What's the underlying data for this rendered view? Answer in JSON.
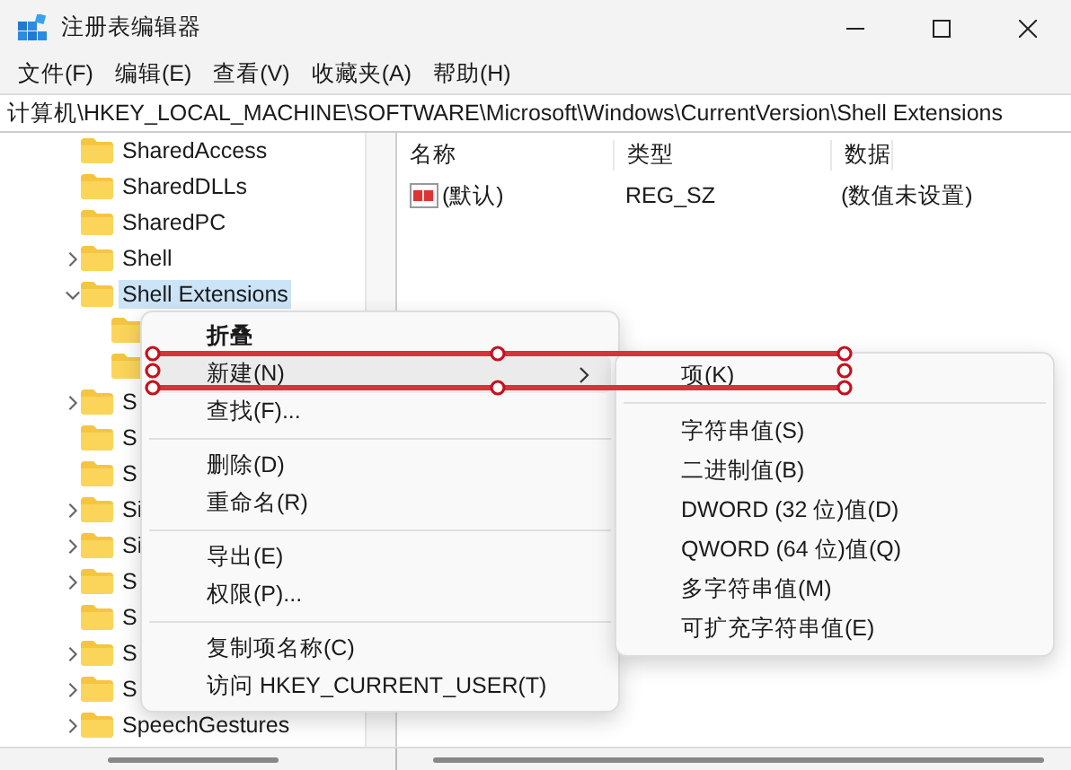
{
  "window": {
    "title": "注册表编辑器"
  },
  "menu": [
    "文件(F)",
    "编辑(E)",
    "查看(V)",
    "收藏夹(A)",
    "帮助(H)"
  ],
  "address": "计算机\\HKEY_LOCAL_MACHINE\\SOFTWARE\\Microsoft\\Windows\\CurrentVersion\\Shell Extensions",
  "tree": [
    {
      "name": "SharedAccess",
      "selected": false
    },
    {
      "name": "SharedDLLs",
      "selected": false
    },
    {
      "name": "SharedPC",
      "selected": false
    },
    {
      "name": "Shell",
      "expanded": false,
      "selected": false
    },
    {
      "name": "Shell Extensions",
      "expanded": true,
      "selected": true,
      "children": [
        {
          "selected": false
        },
        {
          "selected": false
        }
      ]
    },
    {
      "name": "S",
      "expanded": false,
      "selected": false
    },
    {
      "name": "S",
      "selected": false
    },
    {
      "name": "S",
      "selected": false
    },
    {
      "name": "Si",
      "expanded": false,
      "selected": false
    },
    {
      "name": "Si",
      "expanded": false,
      "selected": false
    },
    {
      "name": "S",
      "expanded": false,
      "selected": false
    },
    {
      "name": "S",
      "selected": false
    },
    {
      "name": "S",
      "expanded": false,
      "selected": false
    },
    {
      "name": "S",
      "expanded": false,
      "selected": false
    },
    {
      "name": "SpeechGestures",
      "expanded": false,
      "selected": false
    }
  ],
  "values": {
    "columns": [
      "名称",
      "类型",
      "数据"
    ],
    "rows": [
      {
        "name": "(默认)",
        "type": "REG_SZ",
        "data": "(数值未设置)"
      }
    ]
  },
  "context_menu": {
    "items": [
      {
        "kind": "default",
        "label": "折叠",
        "selected": false
      },
      {
        "kind": "submenu",
        "label": "新建(N)",
        "selected": true
      },
      {
        "kind": "item",
        "label": "查找(F)...",
        "selected": false
      },
      {
        "kind": "separator"
      },
      {
        "kind": "item",
        "label": "删除(D)",
        "selected": false
      },
      {
        "kind": "item",
        "label": "重命名(R)",
        "selected": false
      },
      {
        "kind": "separator"
      },
      {
        "kind": "item",
        "label": "导出(E)",
        "selected": false
      },
      {
        "kind": "item",
        "label": "权限(P)...",
        "selected": false
      },
      {
        "kind": "separator"
      },
      {
        "kind": "item",
        "label": "复制项名称(C)",
        "selected": false
      },
      {
        "kind": "item",
        "label": "访问 HKEY_CURRENT_USER(T)",
        "selected": false
      }
    ]
  },
  "submenu": {
    "items": [
      {
        "kind": "item",
        "label": "项(K)",
        "selected": false
      },
      {
        "kind": "separator"
      },
      {
        "kind": "item",
        "label": "字符串值(S)",
        "selected": false
      },
      {
        "kind": "item",
        "label": "二进制值(B)",
        "selected": false
      },
      {
        "kind": "item",
        "label": "DWORD (32 位)值(D)",
        "selected": false
      },
      {
        "kind": "item",
        "label": "QWORD (64 位)值(Q)",
        "selected": false
      },
      {
        "kind": "item",
        "label": "多字符串值(M)",
        "selected": false
      },
      {
        "kind": "item",
        "label": "可扩充字符串值(E)",
        "selected": false
      }
    ]
  }
}
